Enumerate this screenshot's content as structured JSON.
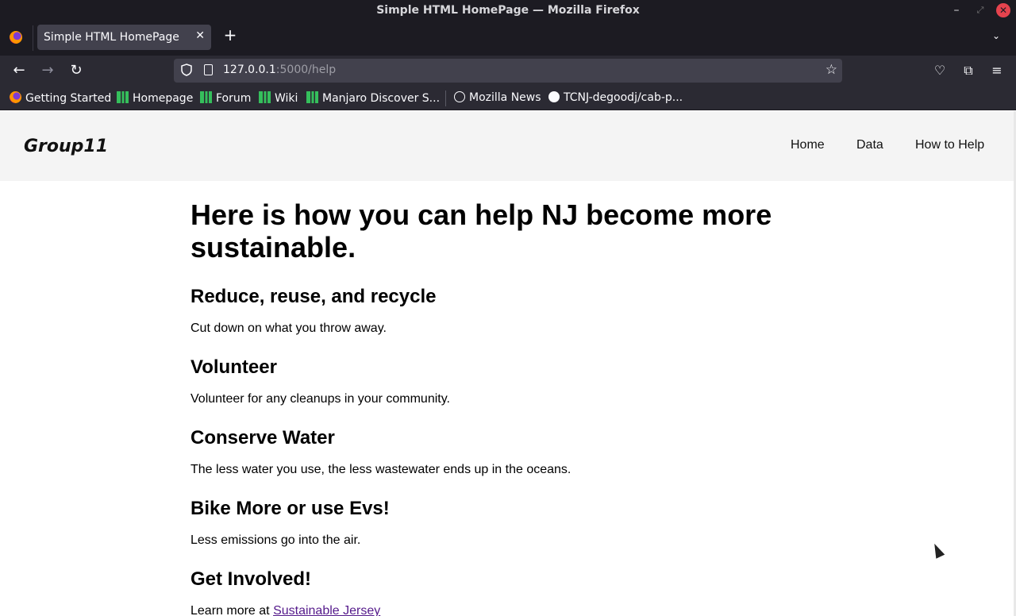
{
  "window": {
    "title": "Simple HTML HomePage — Mozilla Firefox",
    "controls": {
      "minimize": "–",
      "maximize": "⤢",
      "close": "✕"
    }
  },
  "tabs": [
    {
      "label": "Simple HTML HomePage",
      "close": "✕"
    }
  ],
  "tabstrip": {
    "new_tab": "+",
    "list_tabs": "⌄"
  },
  "navbar": {
    "url_host": "127.0.0.1",
    "url_rest": ":5000/help",
    "back": "←",
    "forward": "→",
    "reload": "↻",
    "star": "☆",
    "pocket": "♡",
    "extensions": "⧉",
    "menu": "≡"
  },
  "bookmarks": [
    {
      "label": "Getting Started",
      "icon": "firefox-icon"
    },
    {
      "label": "Homepage",
      "icon": "manjaro-icon"
    },
    {
      "label": "Forum",
      "icon": "manjaro-icon"
    },
    {
      "label": "Wiki",
      "icon": "manjaro-icon"
    },
    {
      "label": "Manjaro Discover S...",
      "icon": "manjaro-icon"
    },
    {
      "label": "Mozilla News",
      "icon": "globe-icon"
    },
    {
      "label": "TCNJ-degoodj/cab-p...",
      "icon": "github-icon"
    }
  ],
  "site": {
    "brand": "Group11",
    "nav": {
      "home": "Home",
      "data": "Data",
      "help": "How to Help"
    }
  },
  "main": {
    "heading": "Here is how you can help NJ become more sustainable.",
    "sections": [
      {
        "title": "Reduce, reuse, and recycle",
        "text": "Cut down on what you throw away."
      },
      {
        "title": "Volunteer",
        "text": "Volunteer for any cleanups in your community."
      },
      {
        "title": "Conserve Water",
        "text": "The less water you use, the less wastewater ends up in the oceans."
      },
      {
        "title": "Bike More or use Evs!",
        "text": "Less emissions go into the air."
      },
      {
        "title": "Get Involved!",
        "text_prefix": "Learn more at ",
        "link": "Sustainable Jersey"
      }
    ]
  },
  "colors": {
    "chrome_dark": "#1c1b22",
    "toolbar": "#2b2a33",
    "header_bg": "#f4f4f4",
    "visited_link": "#551a8b"
  }
}
